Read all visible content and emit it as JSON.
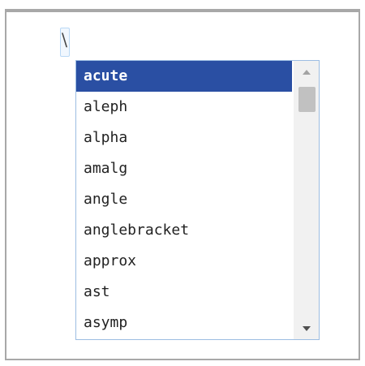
{
  "editor": {
    "input_value": "\\"
  },
  "autocomplete": {
    "selected_index": 0,
    "items": [
      "acute",
      "aleph",
      "alpha",
      "amalg",
      "angle",
      "anglebracket",
      "approx",
      "ast",
      "asymp"
    ],
    "selection_color": "#2a4fa3",
    "border_color": "#9cbde2"
  },
  "scrollbar": {
    "up_icon": "triangle-up-icon",
    "down_icon": "triangle-down-icon"
  }
}
